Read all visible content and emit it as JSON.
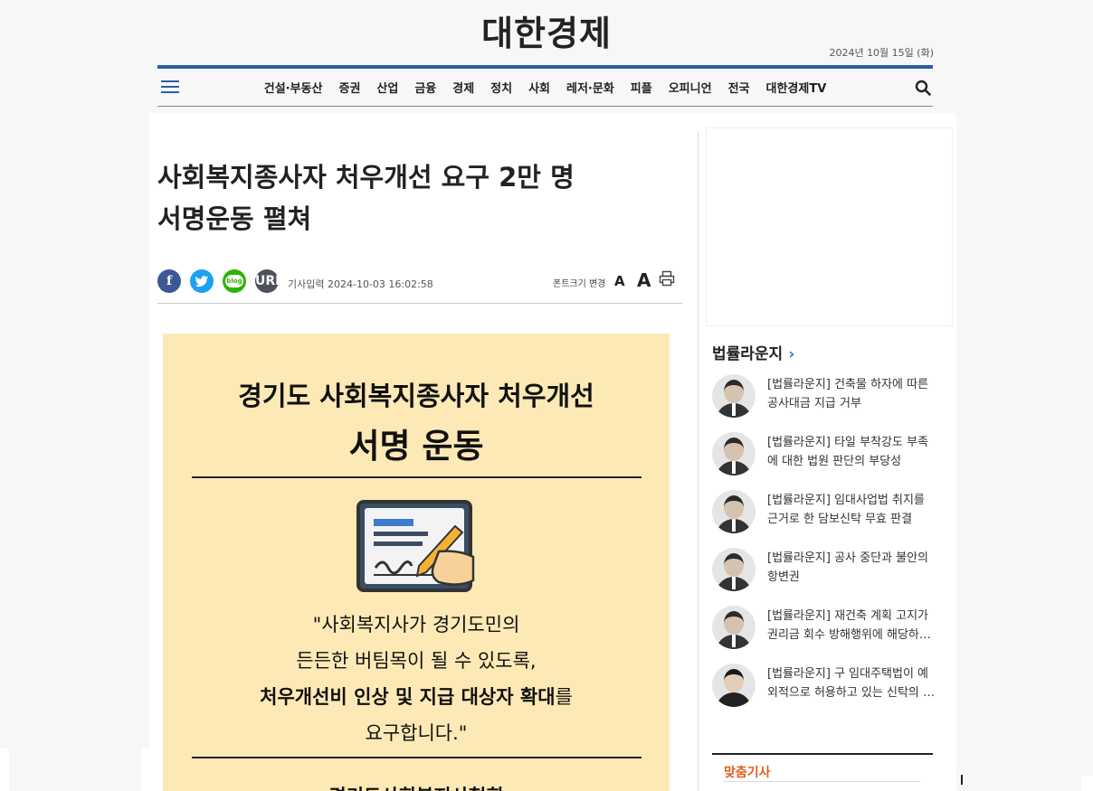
{
  "header": {
    "logo": "대한경제",
    "date": "2024년 10월 15일 (화)"
  },
  "nav": {
    "items": [
      "건설·부동산",
      "증권",
      "산업",
      "금융",
      "경제",
      "정치",
      "사회",
      "레저·문화",
      "피플",
      "오피니언",
      "전국",
      "대한경제TV"
    ]
  },
  "article": {
    "headline_line1": "사회복지종사자 처우개선 요구 2만 명",
    "headline_line2": "서명운동 펼쳐",
    "written": "기사입력 2024-10-03 16:02:58",
    "share": {
      "facebook": "f",
      "blog": "blog",
      "url": "URL"
    },
    "font_label": "폰트크기 변경",
    "font_small": "A",
    "font_large": "A"
  },
  "poster": {
    "title1": "경기도 사회복지종사자 처우개선",
    "title2": "서명 운동",
    "quote1": "\"사회복지사가 경기도민의",
    "quote2": "든든한 버팀목이 될 수 있도록,",
    "quote3_bold": "처우개선비 인상 및 지급 대상자 확대",
    "quote3_rest": "를",
    "quote4": "요구합니다.\"",
    "bottom": "경기도사회복지사협회"
  },
  "sidebar": {
    "section_title": "법률라운지",
    "items": [
      {
        "line1": "[법률라운지] 건축물 하자에 따른",
        "line2": "공사대금 지급 거부"
      },
      {
        "line1": "[법률라운지] 타일 부착강도 부족",
        "line2": "에 대한 법원 판단의 부당성"
      },
      {
        "line1": "[법률라운지] 임대사업법 취지를",
        "line2": "근거로 한 담보신탁 무효 판결"
      },
      {
        "line1": "[법률라운지] 공사 중단과 불안의",
        "line2": "항변권"
      },
      {
        "line1": "[법률라운지] 재건축 계획 고지가",
        "line2": "권리금 회수 방해행위에 해당하…"
      },
      {
        "line1": "[법률라운지] 구 임대주택법이 예",
        "line2": "외적으로 허용하고 있는 신탁의 …"
      }
    ],
    "tailored_title": "맞춤기사"
  },
  "colors": {
    "accent": "#2a5ea7",
    "poster_bg": "#fde9b5",
    "tailored_title": "#e0611a"
  }
}
